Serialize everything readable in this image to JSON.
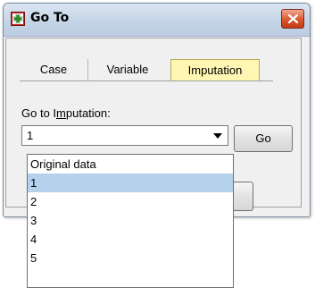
{
  "dialog": {
    "title": "Go To",
    "tabs": [
      {
        "label": "Case"
      },
      {
        "label": "Variable"
      },
      {
        "label": "Imputation",
        "active": true
      }
    ],
    "field_label_before": "Go to I",
    "field_label_mnemonic": "m",
    "field_label_after": "putation:",
    "combo_value": "1",
    "go_button_label": "Go",
    "dropdown_options": [
      "Original data",
      "1",
      "2",
      "3",
      "4",
      "5"
    ],
    "selected_option": "1",
    "colors": {
      "active_tab": "#fff6b4",
      "selected_option": "#b5d1ec",
      "close_button": "#d8562f"
    },
    "icons": {
      "app": "green-plus-grid-icon",
      "close": "close-icon",
      "combo": "chevron-down-icon"
    }
  }
}
